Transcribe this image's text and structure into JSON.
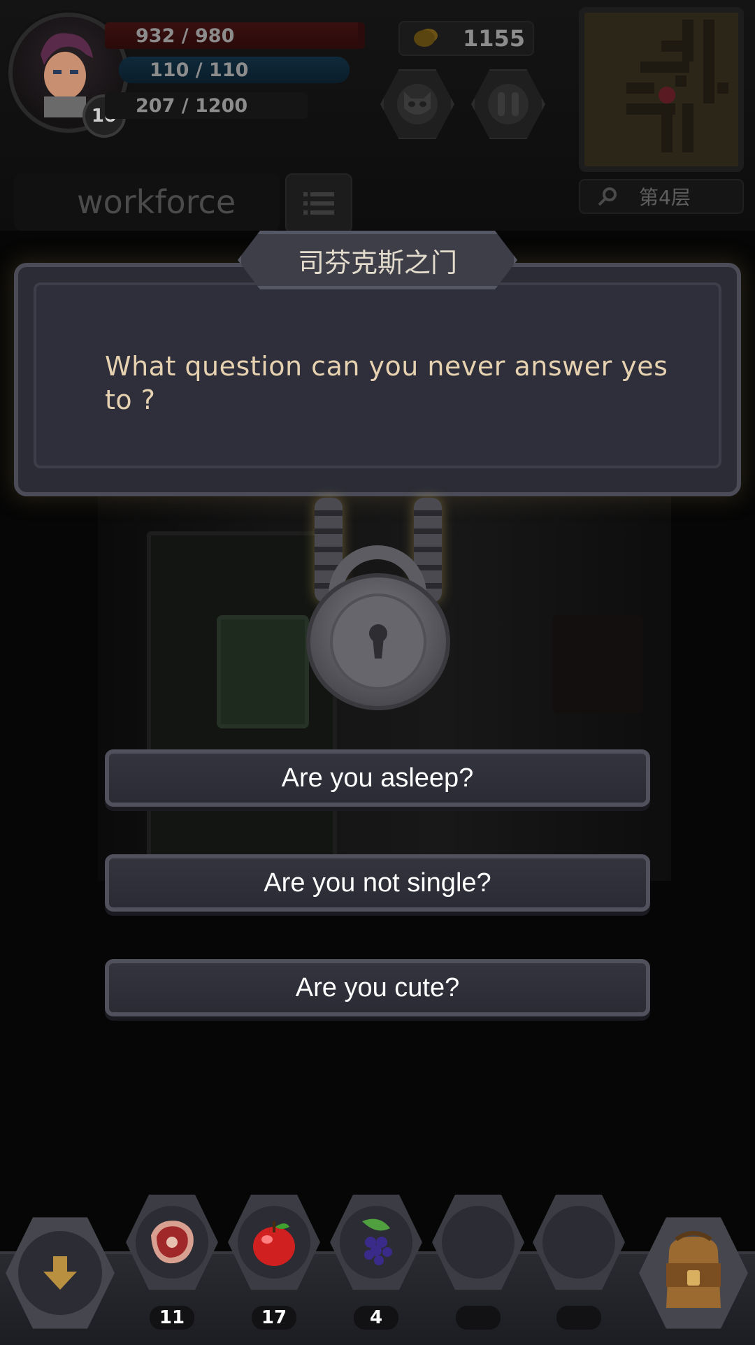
{
  "player": {
    "level": "10",
    "hp": "932 / 980",
    "mp": "110 / 110",
    "xp": "207 / 1200",
    "name": "workforce"
  },
  "gold": "1155",
  "floor_label": "第4层",
  "dialog": {
    "title": "司芬克斯之门",
    "question": "What question can you never answer yes to ?"
  },
  "answers": [
    "Are you asleep?",
    "Are you not single?",
    "Are you cute?"
  ],
  "inventory": [
    {
      "icon": "meat-icon",
      "count": "11"
    },
    {
      "icon": "apple-icon",
      "count": "17"
    },
    {
      "icon": "grapes-icon",
      "count": "4"
    },
    {
      "icon": "empty-slot",
      "count": ""
    },
    {
      "icon": "empty-slot",
      "count": ""
    }
  ],
  "icons": {
    "drop": "arrow-down-icon",
    "bag": "backpack-icon",
    "pet": "demon-face-icon",
    "pause": "pause-icon",
    "search": "search-icon",
    "menu": "list-icon"
  },
  "colors": {
    "hp_bar": "#3a1010",
    "mp_bar": "#0f2a3b",
    "dialog_text": "#e6d2b0",
    "button_text": "#ffffff"
  }
}
